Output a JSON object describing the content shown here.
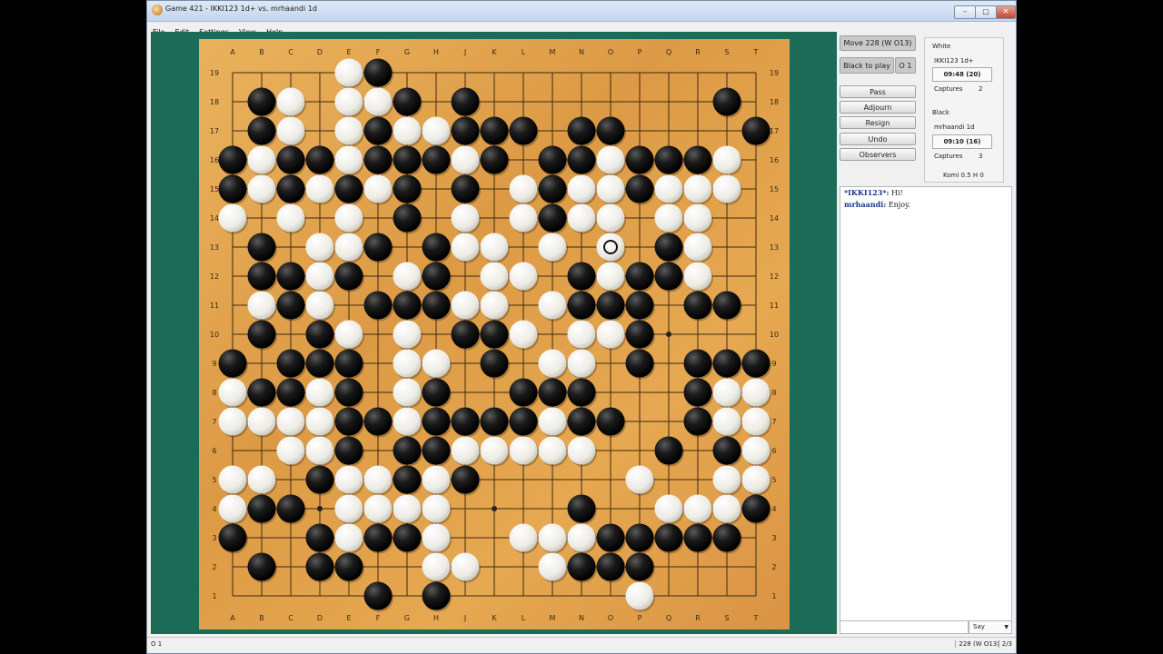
{
  "window": {
    "title": "Game 421 - IKKI123 1d+ vs. mrhaandi 1d",
    "minimize": "–",
    "maximize": "▢",
    "close": "✕"
  },
  "menu": [
    "File",
    "Edit",
    "Settings",
    "View",
    "Help"
  ],
  "board": {
    "size": 19,
    "columns": [
      "A",
      "B",
      "C",
      "D",
      "E",
      "F",
      "G",
      "H",
      "J",
      "K",
      "L",
      "M",
      "N",
      "O",
      "P",
      "Q",
      "R",
      "S",
      "T"
    ],
    "rows": [
      "19",
      "18",
      "17",
      "16",
      "15",
      "14",
      "13",
      "12",
      "11",
      "10",
      "9",
      "8",
      "7",
      "6",
      "5",
      "4",
      "3",
      "2",
      "1"
    ],
    "rows_spec": [
      "....WB.............",
      ".BW.WWB.B........B.",
      ".BW.WBWWBBB.BB....B",
      "BWBBWBBBWB.BBWBBBW.",
      "BWBWBWB.B.WBWWBWWW.",
      "W.W.W.B.W.WBWW.WW..",
      ".B.WWB.BWW.W.W.BW..",
      ".BBWB.WB.WW.BWBBW..",
      ".WBW.BBBWW.WBBB.BB.",
      ".B.BW.W.BBW.WWB....",
      "B.BBB.WW.B.WW.B.BBB",
      "WBBWB.WB..BBB...BWW",
      "WWWWBBWBBBBWBB..BWW",
      "..WWB.BBWWWWW..B.BW",
      "WW.BWWBWB.....W..WW",
      "WBB.WWWW....B..WWWBW",
      "B..BWBBW..WWWBBBBB.",
      ".B.BB..WW..WBBB....",
      ".....B.B......W....B."
    ],
    "last_move": "O13"
  },
  "controls": {
    "move_info": "Move 228 (W O13)",
    "to_play": "Black to play",
    "o_one": "O 1",
    "pass": "Pass",
    "adjourn": "Adjourn",
    "resign": "Resign",
    "undo": "Undo",
    "observers": "Observers"
  },
  "players": {
    "white_header": "White",
    "white_name": "IKKI123 1d+",
    "white_clock": "09:48 (20)",
    "white_captures_label": "Captures",
    "white_captures": "2",
    "black_header": "Black",
    "black_name": "mrhaandi 1d",
    "black_clock": "09:10 (16)",
    "black_captures_label": "Captures",
    "black_captures": "3",
    "komi": "Komi 0.5  H 0"
  },
  "chat": [
    {
      "name": "*IKKI123*:",
      "text": " Hi!"
    },
    {
      "name": "mrhaandi:",
      "text": " Enjoy."
    }
  ],
  "say": "Say",
  "status": {
    "left": "O 1",
    "right": "228 (W O13)",
    "page": "2/3"
  },
  "colors": {
    "board_bg": "#1c6b57",
    "wood": "#e2a24c",
    "black_stone": "#111111",
    "white_stone": "#f6f6f0"
  }
}
